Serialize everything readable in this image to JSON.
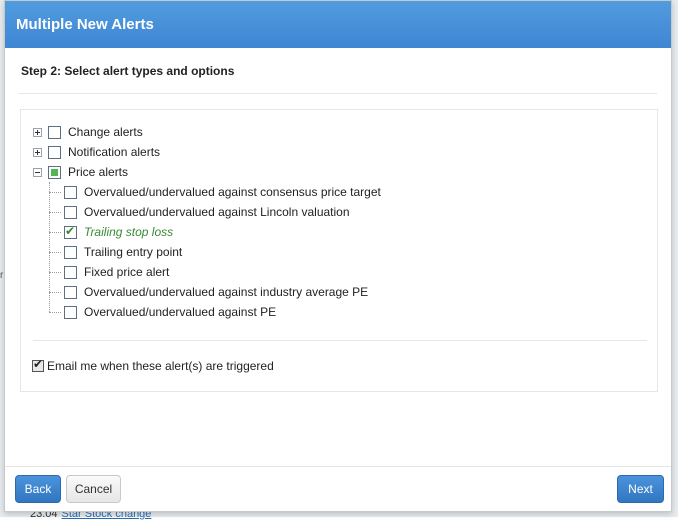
{
  "background": {
    "bottom_prefix": "23.04",
    "bottom_link": "Star Stock change"
  },
  "modal": {
    "title": "Multiple New Alerts",
    "step_title": "Step 2: Select alert types and options",
    "tree": [
      {
        "label": "Change alerts",
        "expanded": false,
        "state": "unchecked"
      },
      {
        "label": "Notification alerts",
        "expanded": false,
        "state": "unchecked"
      },
      {
        "label": "Price alerts",
        "expanded": true,
        "state": "partial",
        "children": [
          {
            "label": "Overvalued/undervalued against consensus price target",
            "checked": false
          },
          {
            "label": "Overvalued/undervalued against Lincoln valuation",
            "checked": false
          },
          {
            "label": "Trailing stop loss",
            "checked": true
          },
          {
            "label": "Trailing entry point",
            "checked": false
          },
          {
            "label": "Fixed price alert",
            "checked": false
          },
          {
            "label": "Overvalued/undervalued against industry average PE",
            "checked": false
          },
          {
            "label": "Overvalued/undervalued against PE",
            "checked": false
          }
        ]
      }
    ],
    "email_label": "Email me when these alert(s) are triggered",
    "email_checked": true,
    "buttons": {
      "back": "Back",
      "cancel": "Cancel",
      "next": "Next"
    },
    "colors": {
      "header": "#4a90d9",
      "accent_green": "#56b551",
      "primary_button": "#3a80cc"
    }
  }
}
